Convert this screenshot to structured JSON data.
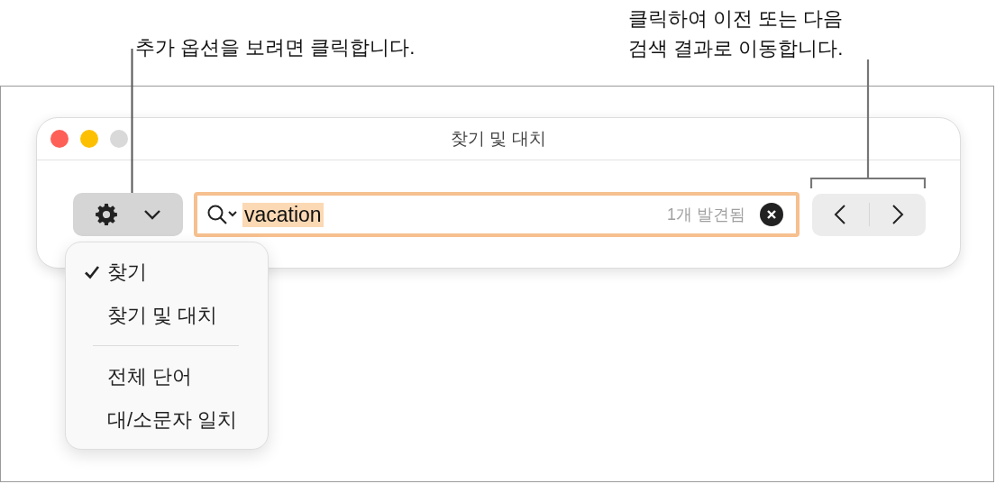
{
  "annotations": [
    {
      "lines": [
        "추가 옵션을 보려면 클릭합니다."
      ]
    },
    {
      "lines": [
        "클릭하여 이전 또는 다음",
        "검색 결과로 이동합니다."
      ]
    }
  ],
  "window": {
    "title": "찾기 및 대치"
  },
  "search": {
    "value": "vacation",
    "value_selected": true,
    "match_count": "1개 발견됨"
  },
  "menu": {
    "groups": [
      [
        {
          "label": "찾기",
          "checked": true
        },
        {
          "label": "찾기 및 대치",
          "checked": false
        }
      ],
      [
        {
          "label": "전체 단어",
          "checked": false
        },
        {
          "label": "대/소문자 일치",
          "checked": false
        }
      ]
    ]
  }
}
